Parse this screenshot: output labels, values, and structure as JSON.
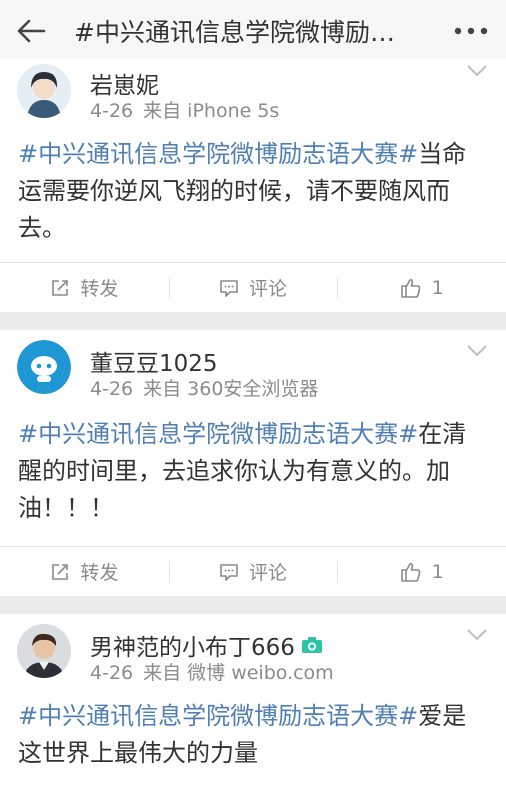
{
  "header": {
    "title": "#中兴通讯信息学院微博励…",
    "back_icon": "back-arrow-icon",
    "more_icon": "more-dots-icon"
  },
  "posts": [
    {
      "username": "岩崽妮",
      "date": "4-26",
      "source": "来自 iPhone 5s",
      "topic": "#中兴通讯信息学院微博励志语大赛#",
      "text": "当命运需要你逆风飞翔的时候，请不要随风而去。",
      "actions": {
        "repost": "转发",
        "comment": "评论",
        "like": "1"
      },
      "avatar": "anime-boy-avatar"
    },
    {
      "username": "董豆豆1025",
      "date": "4-26",
      "source": "来自 360安全浏览器",
      "topic": "#中兴通讯信息学院微博励志语大赛#",
      "text": "在清醒的时间里，去追求你认为有意义的。加油！！！",
      "actions": {
        "repost": "转发",
        "comment": "评论",
        "like": "1"
      },
      "avatar": "robot-avatar"
    },
    {
      "username": "男神范的小布丁666",
      "date": "4-26",
      "source": "来自 微博 weibo.com",
      "topic": "#中兴通讯信息学院微博励志语大赛#",
      "text": "爱是这世界上最伟大的力量",
      "avatar": "man-photo-avatar",
      "badge_icon": "camera-icon"
    }
  ],
  "colors": {
    "topic": "#4f7fb3",
    "meta": "#8b8b8b",
    "action": "#8a8a8a",
    "badge": "#2ec2a8"
  }
}
